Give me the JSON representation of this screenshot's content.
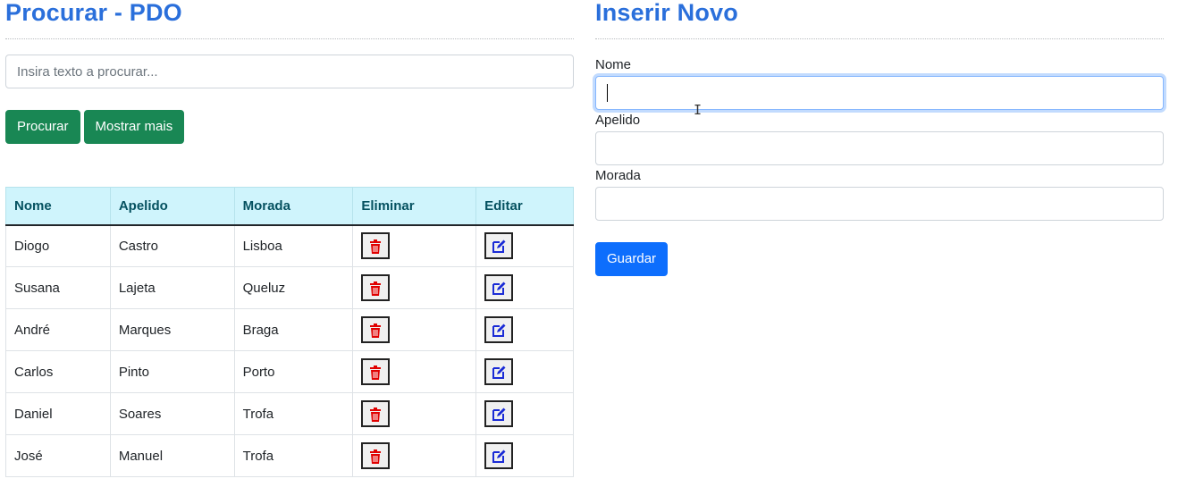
{
  "search_panel": {
    "title": "Procurar - PDO",
    "search": {
      "placeholder": "Insira texto a procurar...",
      "value": ""
    },
    "buttons": {
      "search_label": "Procurar",
      "show_more_label": "Mostrar mais"
    },
    "table": {
      "columns": [
        "Nome",
        "Apelido",
        "Morada",
        "Eliminar",
        "Editar"
      ],
      "rows": [
        {
          "nome": "Diogo",
          "apelido": "Castro",
          "morada": "Lisboa"
        },
        {
          "nome": "Susana",
          "apelido": "Lajeta",
          "morada": "Queluz"
        },
        {
          "nome": "André",
          "apelido": "Marques",
          "morada": "Braga"
        },
        {
          "nome": "Carlos",
          "apelido": "Pinto",
          "morada": "Porto"
        },
        {
          "nome": "Daniel",
          "apelido": "Soares",
          "morada": "Trofa"
        },
        {
          "nome": "José",
          "apelido": "Manuel",
          "morada": "Trofa"
        }
      ],
      "delete_icon": "trash-icon",
      "edit_icon": "edit-icon"
    }
  },
  "insert_panel": {
    "title": "Inserir Novo",
    "fields": {
      "nome_label": "Nome",
      "apelido_label": "Apelido",
      "morada_label": "Morada"
    },
    "save_label": "Guardar"
  },
  "colors": {
    "title": "#2a6fdb",
    "green_button": "#198754",
    "blue_button": "#0d6efd",
    "table_header_bg": "#cff4fc",
    "trash_icon": "#e00000",
    "edit_icon": "#1a2bd6"
  }
}
